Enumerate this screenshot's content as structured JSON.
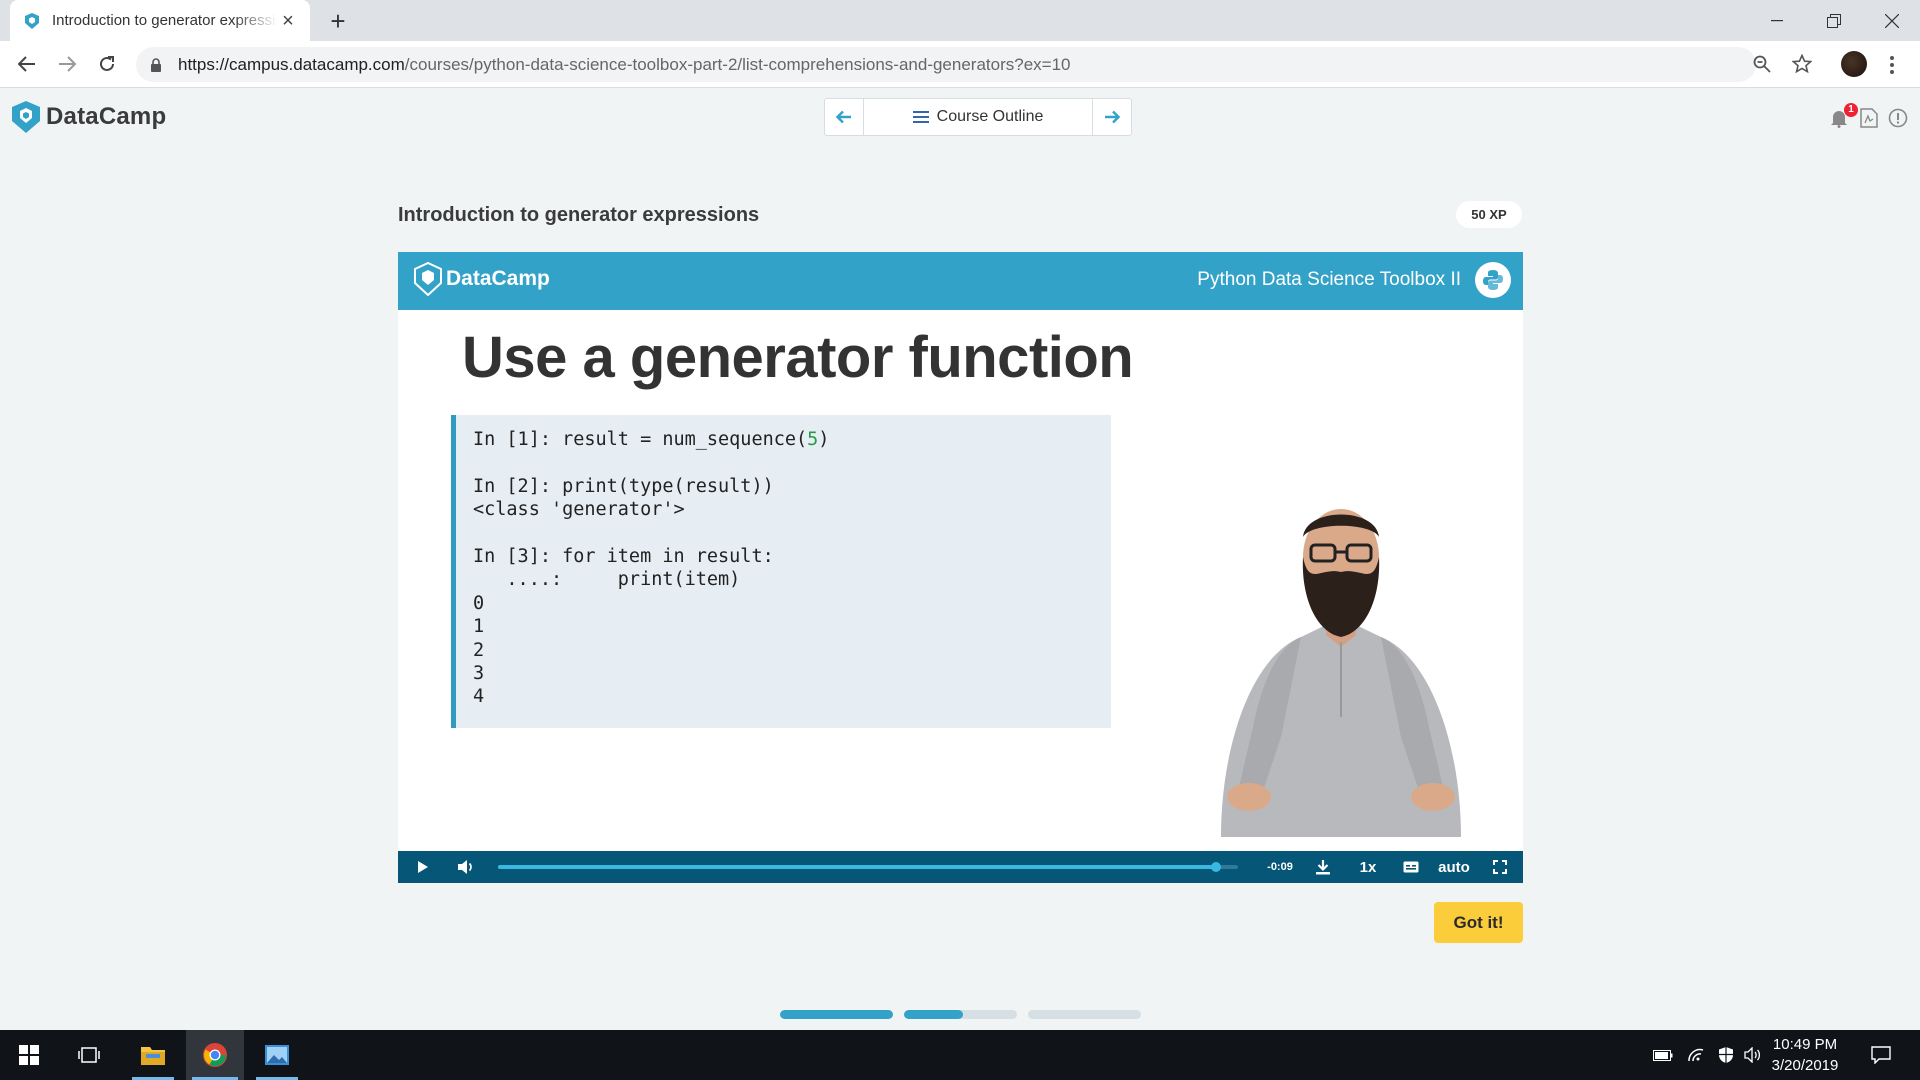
{
  "browser": {
    "tab_title": "Introduction to generator expressions",
    "url_host": "https://campus.datacamp.com",
    "url_path": "/courses/python-data-science-toolbox-part-2/list-comprehensions-and-generators?ex=10"
  },
  "header": {
    "logo_text": "DataCamp",
    "course_outline_label": "Course Outline",
    "notification_count": "1"
  },
  "exercise": {
    "title": "Introduction to generator expressions",
    "xp": "50 XP"
  },
  "video": {
    "logo_text": "DataCamp",
    "course_name": "Python Data Science Toolbox II",
    "slide_title": "Use a generator function",
    "code_lines": [
      "In [1]: result = num_sequence(",
      "In [2]: print(type(result))",
      "<class 'generator'>",
      "In [3]: for item in result:",
      "   ....:     print(item)",
      "0",
      "1",
      "2",
      "3",
      "4"
    ],
    "code_arg": "5",
    "code_close": ")",
    "progress": 0.97,
    "time_remaining": "-0:09",
    "speed": "1x",
    "quality": "auto"
  },
  "actions": {
    "got_it": "Got it!"
  },
  "pager": {
    "segments": [
      1.0,
      0.52,
      0.0
    ]
  },
  "taskbar": {
    "time": "10:49 PM",
    "date": "3/20/2019"
  },
  "colors": {
    "brand_blue": "#33a2c9",
    "control_bar": "#055677",
    "got_it": "#fccd3a"
  }
}
